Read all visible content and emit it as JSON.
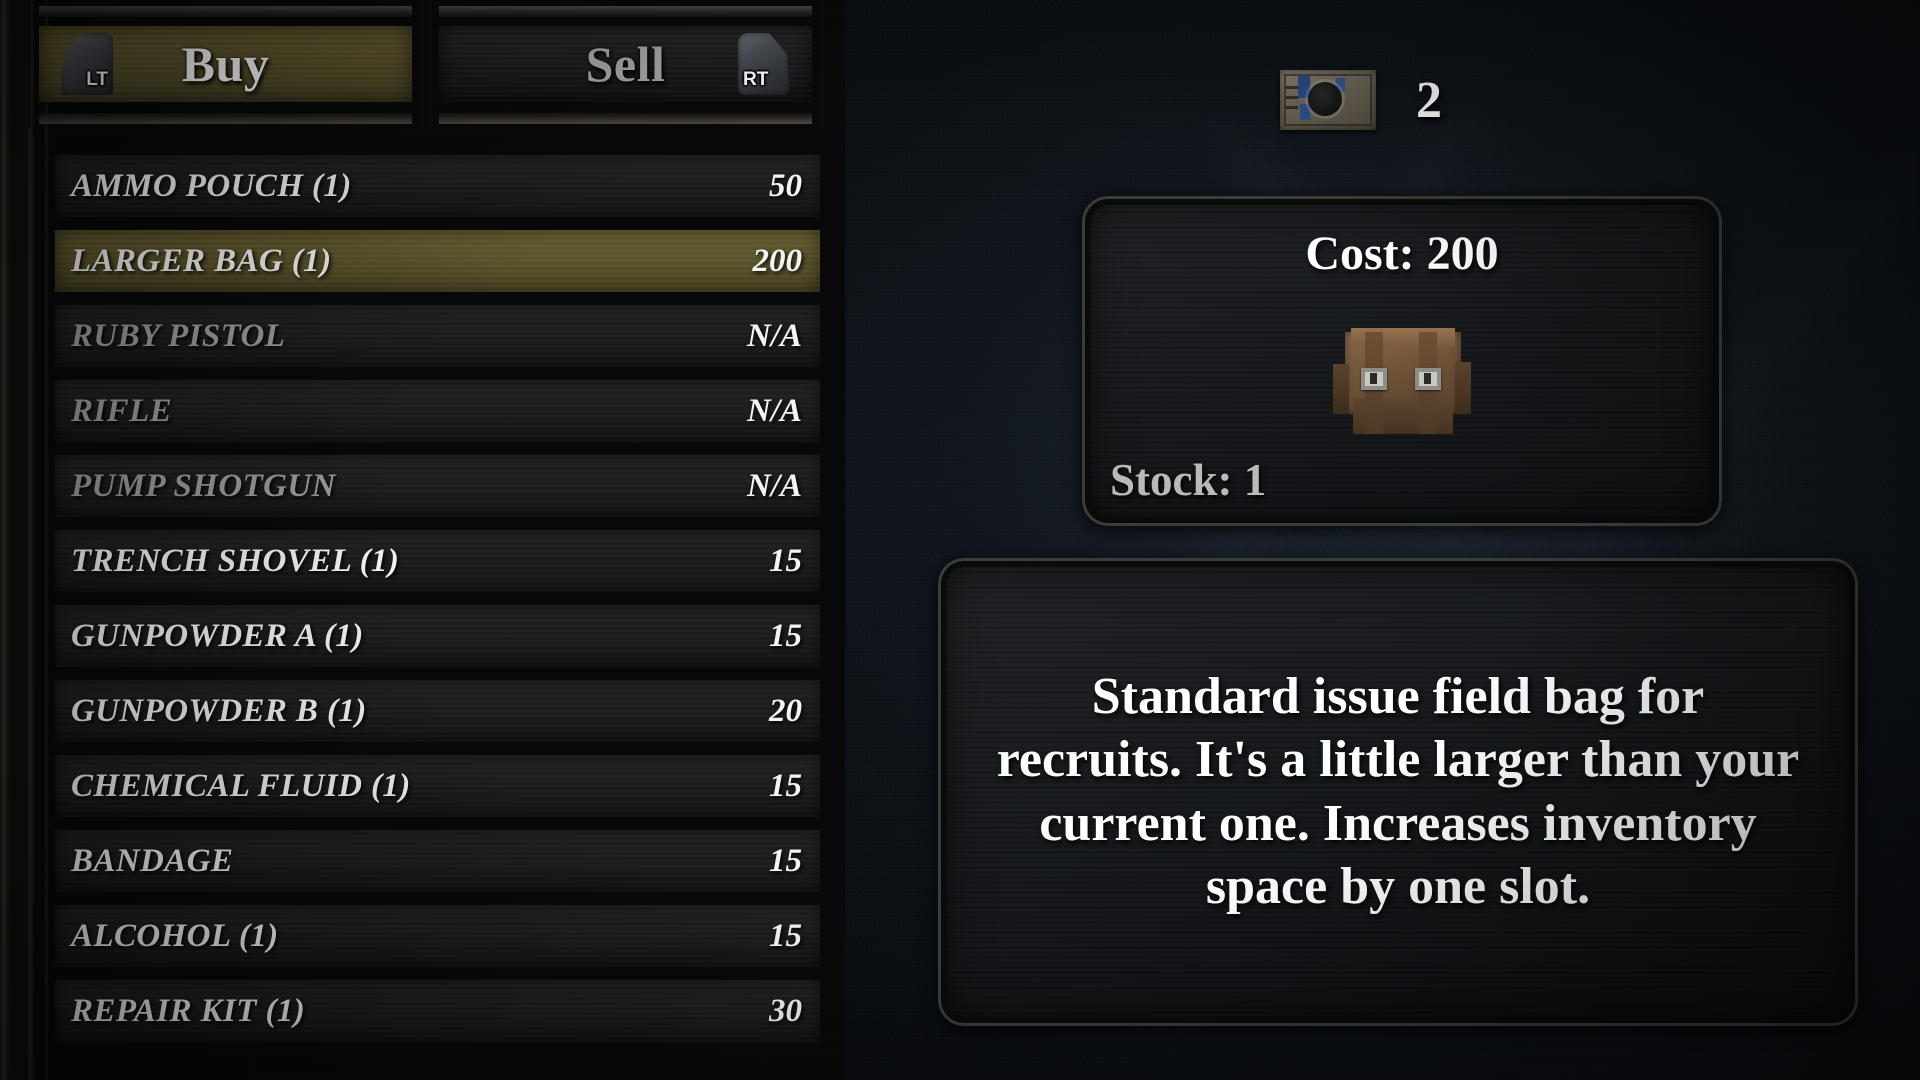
{
  "tabs": [
    {
      "id": "buy",
      "label": "Buy",
      "trigger": "LT",
      "selected": true
    },
    {
      "id": "sell",
      "label": "Sell",
      "trigger": "RT",
      "selected": false
    }
  ],
  "currency": {
    "icon": "banknote-icon",
    "amount": "2"
  },
  "shop_list": {
    "items": [
      {
        "name": "AMMO POUCH  (1)",
        "price": "50",
        "selected": false,
        "disabled": false
      },
      {
        "name": "LARGER BAG  (1)",
        "price": "200",
        "selected": true,
        "disabled": false
      },
      {
        "name": "RUBY PISTOL",
        "price": "N/A",
        "selected": false,
        "disabled": true
      },
      {
        "name": "RIFLE",
        "price": "N/A",
        "selected": false,
        "disabled": true
      },
      {
        "name": "PUMP SHOTGUN",
        "price": "N/A",
        "selected": false,
        "disabled": true
      },
      {
        "name": "TRENCH SHOVEL  (1)",
        "price": "15",
        "selected": false,
        "disabled": false
      },
      {
        "name": "GUNPOWDER A  (1)",
        "price": "15",
        "selected": false,
        "disabled": false
      },
      {
        "name": "GUNPOWDER B  (1)",
        "price": "20",
        "selected": false,
        "disabled": false
      },
      {
        "name": "CHEMICAL FLUID  (1)",
        "price": "15",
        "selected": false,
        "disabled": false
      },
      {
        "name": "BANDAGE",
        "price": "15",
        "selected": false,
        "disabled": false
      },
      {
        "name": "ALCOHOL  (1)",
        "price": "15",
        "selected": false,
        "disabled": false
      },
      {
        "name": "REPAIR KIT  (1)",
        "price": "30",
        "selected": false,
        "disabled": false
      }
    ]
  },
  "detail": {
    "cost_label": "Cost: 200",
    "stock_label": "Stock: 1",
    "sprite": "backpack-sprite",
    "description": "Standard issue field bag for recruits. It's a little larger than your current one. Increases inventory space by one slot."
  },
  "colors": {
    "selection_olive": "#5d552c",
    "panel_dark": "#1d1d1e",
    "text_primary": "#f4f4f2",
    "text_disabled": "#9b9b9b",
    "background": "#0a0e13"
  }
}
